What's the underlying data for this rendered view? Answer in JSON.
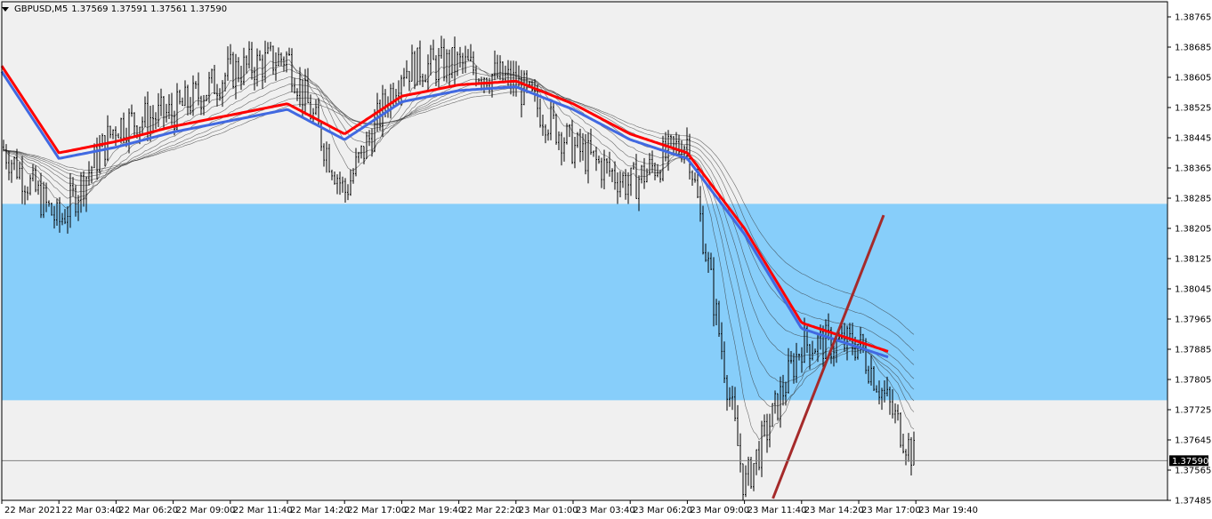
{
  "window": {
    "symbol_tf": "GBPUSD,M5",
    "ohlc": "1.37569 1.37591 1.37561 1.37590"
  },
  "colors": {
    "background": "#f0f0f0",
    "zone": "#87cefa",
    "ema_red": "#ff0000",
    "ema_blue": "#4169e1",
    "ribbon": "#333333",
    "trendline": "#a52a2a",
    "bid_line": "#808080"
  },
  "chart_data": {
    "type": "candlestick",
    "symbol": "GBPUSD",
    "timeframe": "M5",
    "ylim": [
      1.37485,
      1.38805
    ],
    "y_ticks": [
      "1.38765",
      "1.38685",
      "1.38605",
      "1.38525",
      "1.38445",
      "1.38365",
      "1.38285",
      "1.38205",
      "1.38125",
      "1.38045",
      "1.37965",
      "1.37885",
      "1.37805",
      "1.37725",
      "1.37645",
      "1.37565",
      "1.37485"
    ],
    "x_ticks": [
      "22 Mar 2021",
      "22 Mar 03:40",
      "22 Mar 06:20",
      "22 Mar 09:00",
      "22 Mar 11:40",
      "22 Mar 14:20",
      "22 Mar 17:00",
      "22 Mar 19:40",
      "22 Mar 22:20",
      "23 Mar 01:00",
      "23 Mar 03:40",
      "23 Mar 06:20",
      "23 Mar 09:00",
      "23 Mar 11:40",
      "23 Mar 14:20",
      "23 Mar 17:00",
      "23 Mar 19:40"
    ],
    "current_price": "1.37590",
    "zone": {
      "from": 1.3775,
      "to": 1.3827
    },
    "trendline": {
      "from": [
        "23 Mar 11:40",
        1.3749
      ],
      "to": [
        "23 Mar 17:00",
        1.3824
      ]
    },
    "price_path": [
      [
        "22 Mar 2021",
        1.3842
      ],
      [
        "22 Mar 03:40",
        1.3822
      ],
      [
        "22 Mar 06:20",
        1.3848
      ],
      [
        "22 Mar 09:00",
        1.3851
      ],
      [
        "22 Mar 11:40",
        1.3862
      ],
      [
        "22 Mar 14:20",
        1.3866
      ],
      [
        "22 Mar 17:00",
        1.383
      ],
      [
        "22 Mar 19:40",
        1.3863
      ],
      [
        "22 Mar 22:20",
        1.3864
      ],
      [
        "23 Mar 01:00",
        1.3859
      ],
      [
        "23 Mar 03:40",
        1.3842
      ],
      [
        "23 Mar 06:20",
        1.3832
      ],
      [
        "23 Mar 09:00",
        1.3844
      ],
      [
        "23 Mar 11:40",
        1.3752
      ],
      [
        "23 Mar 14:20",
        1.379
      ],
      [
        "23 Mar 17:00",
        1.379
      ],
      [
        "23 Mar 19:40",
        1.3759
      ]
    ],
    "ema_slow_path": [
      [
        "22 Mar 2021",
        1.3863
      ],
      [
        "22 Mar 03:40",
        1.384
      ],
      [
        "22 Mar 06:20",
        1.3843
      ],
      [
        "22 Mar 09:00",
        1.3847
      ],
      [
        "22 Mar 11:40",
        1.385
      ],
      [
        "22 Mar 14:20",
        1.3853
      ],
      [
        "22 Mar 17:00",
        1.3845
      ],
      [
        "22 Mar 19:40",
        1.3855
      ],
      [
        "22 Mar 22:20",
        1.3858
      ],
      [
        "23 Mar 01:00",
        1.3859
      ],
      [
        "23 Mar 03:40",
        1.3853
      ],
      [
        "23 Mar 06:20",
        1.3845
      ],
      [
        "23 Mar 09:00",
        1.384
      ],
      [
        "23 Mar 11:40",
        1.382
      ],
      [
        "23 Mar 14:20",
        1.3795
      ],
      [
        "23 Mar 17:00",
        1.379
      ],
      [
        "23 Mar 19:40",
        1.3785
      ]
    ]
  }
}
